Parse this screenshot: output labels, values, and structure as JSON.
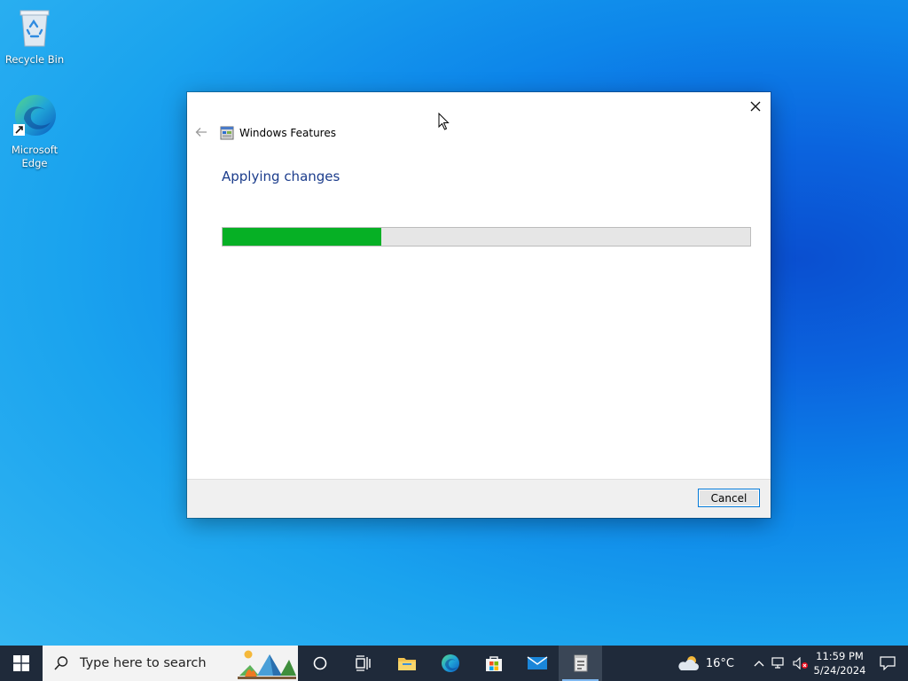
{
  "desktop": {
    "icons": [
      {
        "label": "Recycle Bin"
      },
      {
        "label": "Microsoft Edge"
      }
    ]
  },
  "dialog": {
    "title": "Windows Features",
    "heading": "Applying changes",
    "progress_fraction": 0.3,
    "cancel_label": "Cancel"
  },
  "taskbar": {
    "search_placeholder": "Type here to search",
    "apps": [
      "cortana-icon",
      "task-view-icon",
      "file-explorer-icon",
      "edge-icon",
      "store-icon",
      "mail-icon",
      "windows-features-icon"
    ],
    "weather_temp": "16°C",
    "time": "11:59 PM",
    "date": "5/24/2024"
  },
  "colors": {
    "progress_fill": "#06b025",
    "heading_text": "#1c3d8c",
    "taskbar_bg": "#1f2a3a",
    "cancel_border": "#0078d7"
  }
}
